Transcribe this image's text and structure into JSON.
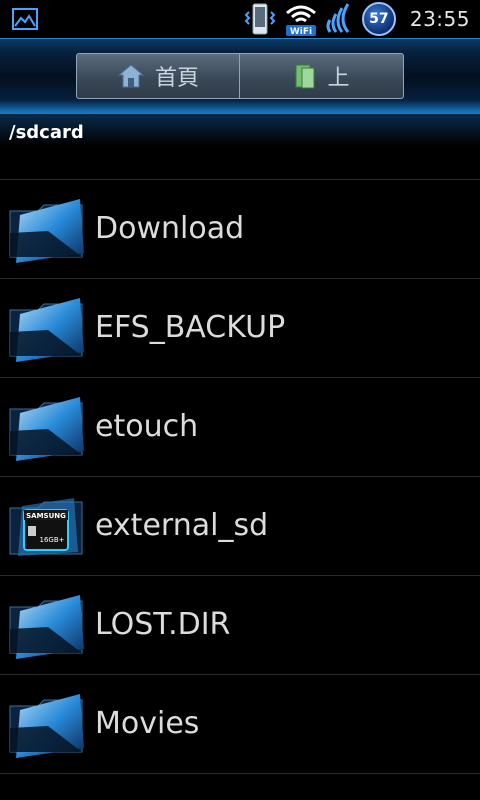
{
  "statusbar": {
    "battery_level": "57",
    "time": "23:55",
    "wifi_label": "WiFi",
    "icons": [
      "gallery-icon",
      "vibrate-icon",
      "wifi-icon",
      "signal-icon",
      "battery-icon"
    ]
  },
  "toolbar": {
    "home_label": "首頁",
    "up_label": "上"
  },
  "path": {
    "current": "/sdcard"
  },
  "list": {
    "items": [
      {
        "name": "Download",
        "icon": "folder-icon"
      },
      {
        "name": "EFS_BACKUP",
        "icon": "folder-icon"
      },
      {
        "name": "etouch",
        "icon": "folder-icon"
      },
      {
        "name": "external_sd",
        "icon": "sdcard-folder-icon",
        "card_brand": "SAMSUNG",
        "card_capacity": "16GB+"
      },
      {
        "name": "LOST.DIR",
        "icon": "folder-icon"
      },
      {
        "name": "Movies",
        "icon": "folder-icon"
      }
    ]
  },
  "colors": {
    "accent": "#1a86d8",
    "background": "#000000",
    "text": "#dcdcdc"
  }
}
